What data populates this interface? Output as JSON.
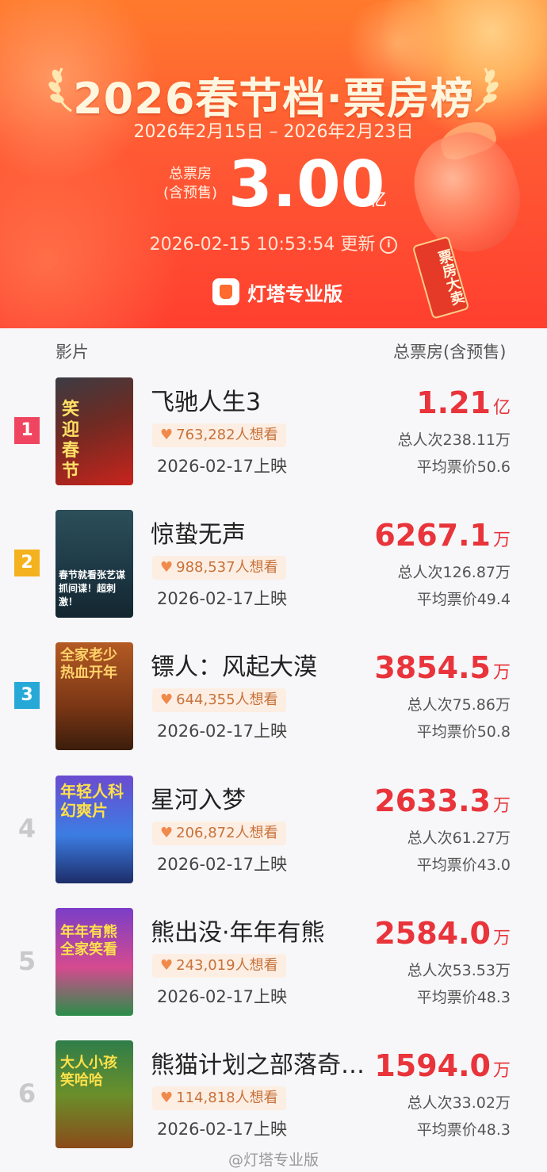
{
  "header": {
    "title": "2026春节档·票房榜",
    "date_range": "2026年2月15日 – 2026年2月23日",
    "total_label": "总票房",
    "total_sublabel": "(含预售)",
    "total_value": "3.00",
    "total_unit": "亿",
    "updated": "2026-02-15 10:53:54 更新",
    "brand": "灯塔专业版",
    "tag": "票房大卖",
    "bg_color": "#ff5a34"
  },
  "columns": {
    "film": "影片",
    "box_office": "总票房(含预售)"
  },
  "movies": [
    {
      "rank": "1",
      "title": "飞驰人生3",
      "want": "763,282人想看",
      "release": "2026-02-17上映",
      "box_value": "1.21",
      "box_unit": "亿",
      "viewers": "总人次238.11万",
      "avg_price": "平均票价50.6",
      "poster_text": "笑迎春节"
    },
    {
      "rank": "2",
      "title": "惊蛰无声",
      "want": "988,537人想看",
      "release": "2026-02-17上映",
      "box_value": "6267.1",
      "box_unit": "万",
      "viewers": "总人次126.87万",
      "avg_price": "平均票价49.4",
      "poster_text": "春节就看张艺谋 抓间谍！超刺激！"
    },
    {
      "rank": "3",
      "title": "镖人：风起大漠",
      "want": "644,355人想看",
      "release": "2026-02-17上映",
      "box_value": "3854.5",
      "box_unit": "万",
      "viewers": "总人次75.86万",
      "avg_price": "平均票价50.8",
      "poster_text": "全家老少 热血开年"
    },
    {
      "rank": "4",
      "title": "星河入梦",
      "want": "206,872人想看",
      "release": "2026-02-17上映",
      "box_value": "2633.3",
      "box_unit": "万",
      "viewers": "总人次61.27万",
      "avg_price": "平均票价43.0",
      "poster_text": "年轻人科幻爽片"
    },
    {
      "rank": "5",
      "title": "熊出没·年年有熊",
      "want": "243,019人想看",
      "release": "2026-02-17上映",
      "box_value": "2584.0",
      "box_unit": "万",
      "viewers": "总人次53.53万",
      "avg_price": "平均票价48.3",
      "poster_text": "年年有熊 全家笑看"
    },
    {
      "rank": "6",
      "title": "熊猫计划之部落奇遇记",
      "want": "114,818人想看",
      "release": "2026-02-17上映",
      "box_value": "1594.0",
      "box_unit": "万",
      "viewers": "总人次33.02万",
      "avg_price": "平均票价48.3",
      "poster_text": "大人小孩 笑哈哈"
    }
  ],
  "footer": "@灯塔专业版"
}
